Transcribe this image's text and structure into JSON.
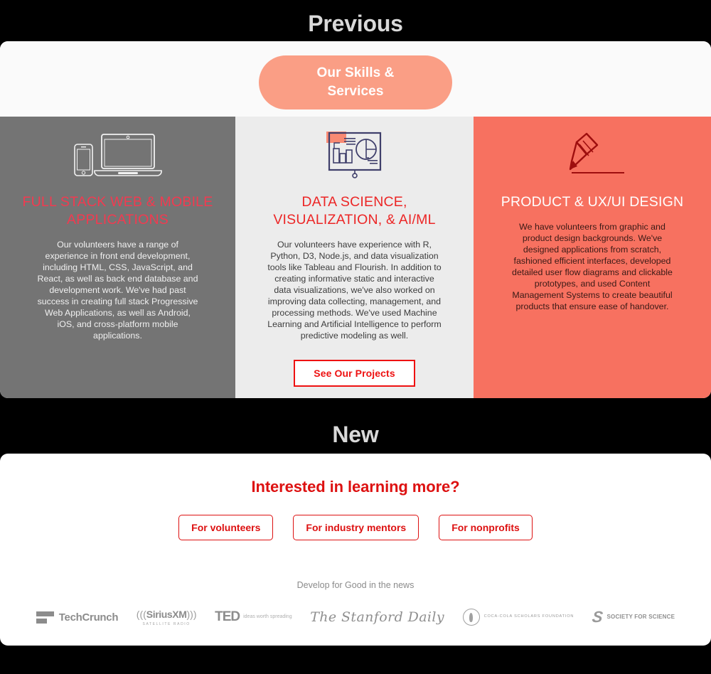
{
  "sections": {
    "previous_label": "Previous",
    "new_label": "New"
  },
  "previous": {
    "pill_label": "Our Skills & Services",
    "columns": [
      {
        "id": "fullstack",
        "icon": "laptop-phone-icon",
        "title": "FULL STACK WEB & MOBILE APPLICATIONS",
        "body": "Our volunteers have a range of experience in front end development, including HTML, CSS, JavaScript, and React, as well as back end database and development work. We've had past success in creating full stack Progressive Web Applications, as well as Android, iOS, and cross-platform mobile applications.",
        "bg": "#747474",
        "title_color": "#f23a50"
      },
      {
        "id": "data",
        "icon": "presentation-chart-icon",
        "title": "DATA SCIENCE, VISUALIZATION, & AI/ML",
        "body": "Our volunteers have experience with R, Python, D3, Node.js, and data visualization tools like Tableau and Flourish. In addition to creating informative static and interactive data visualizations, we've also worked on improving data collecting, management, and processing methods. We've used Machine Learning and Artificial Intelligence to perform predictive modeling as well.",
        "bg": "#ececec",
        "title_color": "#ec2626"
      },
      {
        "id": "design",
        "icon": "pencil-icon",
        "title": "PRODUCT & UX/UI DESIGN",
        "body": "We have volunteers from graphic and product design backgrounds. We've designed applications from scratch, fashioned efficient interfaces, developed detailed user flow diagrams and clickable prototypes, and used Content Management Systems to create beautiful products that ensure ease of handover.",
        "bg": "#f77160",
        "title_color": "#ffffff"
      }
    ],
    "projects_button": "See Our Projects"
  },
  "new": {
    "heading": "Interested in learning more?",
    "ctas": [
      {
        "label": "For volunteers"
      },
      {
        "label": "For industry mentors"
      },
      {
        "label": "For nonprofits"
      }
    ],
    "news_label": "Develop for Good in the news",
    "logos": [
      {
        "name": "techcrunch-logo",
        "text": "TechCrunch"
      },
      {
        "name": "siriusxm-logo",
        "text": "SiriusXM",
        "sub": "SATELLITE RADIO"
      },
      {
        "name": "ted-logo",
        "text": "TED",
        "sub": "ideas worth spreading"
      },
      {
        "name": "stanford-daily-logo",
        "text": "The Stanford Daily"
      },
      {
        "name": "coca-cola-scholars-logo",
        "text": "COCA-COLA SCHOLARS FOUNDATION"
      },
      {
        "name": "society-for-science-logo",
        "text": "SOCIETY FOR SCIENCE"
      }
    ]
  },
  "colors": {
    "accent_coral": "#f77160",
    "accent_red": "#dd1111",
    "pill_coral": "#fa9e85",
    "gray_column": "#747474",
    "light_column": "#ececec"
  }
}
